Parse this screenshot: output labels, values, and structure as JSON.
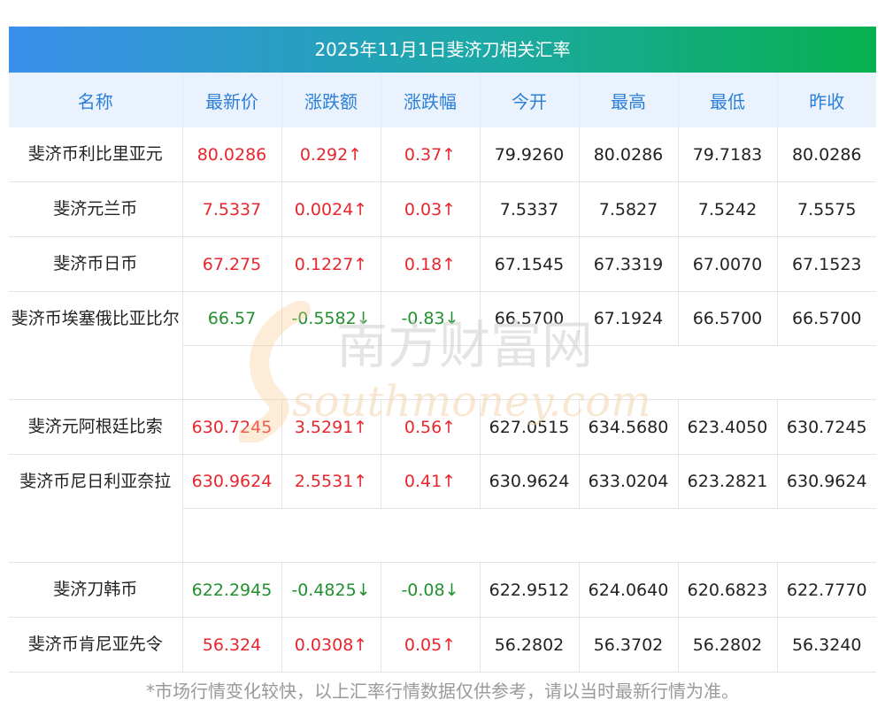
{
  "title": "2025年11月1日斐济刀相关汇率",
  "headers": [
    "名称",
    "最新价",
    "涨跌额",
    "涨跌幅",
    "今开",
    "最高",
    "最低",
    "昨收"
  ],
  "rows": [
    {
      "name": "斐济币利比里亚元",
      "latest": "80.0286",
      "change": "0.292↑",
      "pct": "0.37↑",
      "open": "79.9260",
      "high": "80.0286",
      "low": "79.7183",
      "prev": "80.0286",
      "dir": "up"
    },
    {
      "name": "斐济元兰币",
      "latest": "7.5337",
      "change": "0.0024↑",
      "pct": "0.03↑",
      "open": "7.5337",
      "high": "7.5827",
      "low": "7.5242",
      "prev": "7.5575",
      "dir": "up"
    },
    {
      "name": "斐济币日币",
      "latest": "67.275",
      "change": "0.1227↑",
      "pct": "0.18↑",
      "open": "67.1545",
      "high": "67.3319",
      "low": "67.0070",
      "prev": "67.1523",
      "dir": "up"
    },
    {
      "name": "斐济币埃塞俄比亚比尔",
      "latest": "66.57",
      "change": "-0.5582↓",
      "pct": "-0.83↓",
      "open": "66.5700",
      "high": "67.1924",
      "low": "66.5700",
      "prev": "66.5700",
      "dir": "down"
    },
    {
      "name": "斐济元阿根廷比索",
      "latest": "630.7245",
      "change": "3.5291↑",
      "pct": "0.56↑",
      "open": "627.0515",
      "high": "634.5680",
      "low": "623.4050",
      "prev": "630.7245",
      "dir": "up"
    },
    {
      "name": "斐济币尼日利亚奈拉",
      "latest": "630.9624",
      "change": "2.5531↑",
      "pct": "0.41↑",
      "open": "630.9624",
      "high": "633.0204",
      "low": "623.2821",
      "prev": "630.9624",
      "dir": "up"
    },
    {
      "name": "斐济刀韩币",
      "latest": "622.2945",
      "change": "-0.4825↓",
      "pct": "-0.08↓",
      "open": "622.9512",
      "high": "624.0640",
      "low": "620.6823",
      "prev": "622.7770",
      "dir": "down"
    },
    {
      "name": "斐济币肯尼亚先令",
      "latest": "56.324",
      "change": "0.0308↑",
      "pct": "0.05↑",
      "open": "56.2802",
      "high": "56.3702",
      "low": "56.2802",
      "prev": "56.3240",
      "dir": "up"
    }
  ],
  "footnote": "*市场行情变化较快，以上汇率行情数据仅供参考，请以当时最新行情为准。",
  "watermark": {
    "cn": "南方财富网",
    "en": "southmoney.com"
  },
  "colors": {
    "up": "#e8262d",
    "down": "#21902f",
    "header_text": "#2b7fd8",
    "header_bg": "#eaf3fd",
    "title_start": "#3b8fec",
    "title_end": "#07b04f"
  }
}
